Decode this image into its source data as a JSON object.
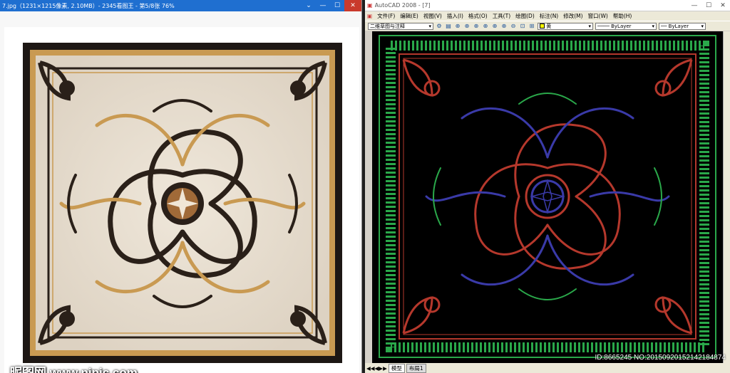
{
  "viewer": {
    "title": "7.jpg（1231×1215像素, 2.10MB）- 2345看图王 - 第5/8张 76%",
    "watermark": "昵图网 www.nipic.com"
  },
  "cad": {
    "title": "AutoCAD 2008 - [7]",
    "menu": [
      "文件(F)",
      "编辑(E)",
      "视图(V)",
      "插入(I)",
      "格式(O)",
      "工具(T)",
      "绘图(D)",
      "标注(N)",
      "修改(M)",
      "窗口(W)",
      "帮助(H)"
    ],
    "workspace": "二维草图与注释",
    "layer_color": "黄",
    "linetype": "ByLayer",
    "lineweight": "ByLayer",
    "tabs": [
      "模型",
      "布局1"
    ],
    "id_mark": "ID:8665245 NO:20150920152142184874"
  },
  "colors": {
    "marble": "#e8dfd2",
    "gold": "#c99a52",
    "dark_brown": "#2a2019",
    "cad_red": "#b5382c",
    "cad_green": "#2aa84a",
    "cad_blue": "#3a3aa8"
  }
}
